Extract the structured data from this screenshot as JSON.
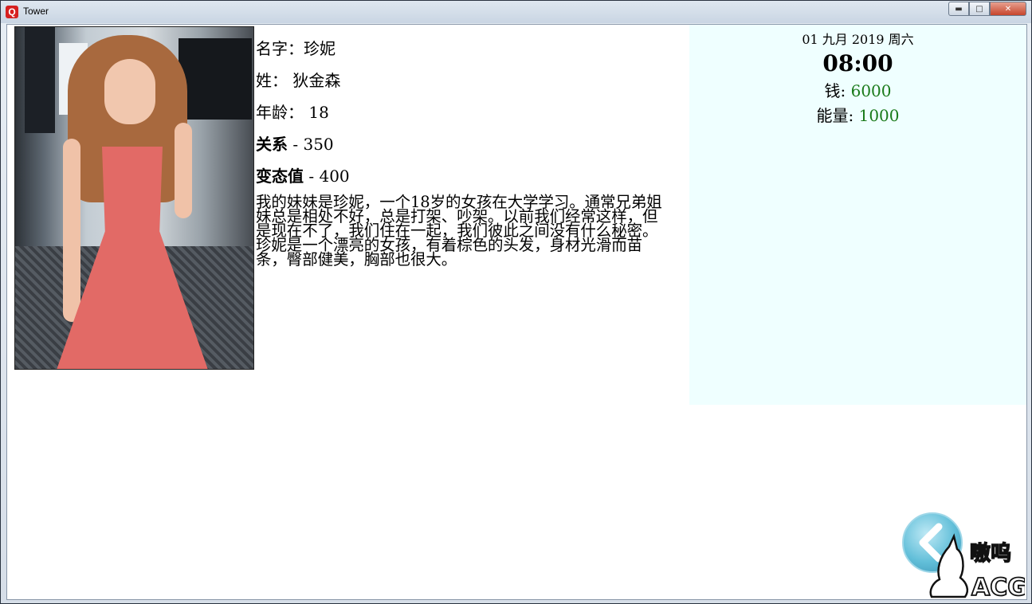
{
  "window": {
    "title": "Tower",
    "app_icon_letter": "Q",
    "min_glyph": "▬",
    "max_glyph": "□",
    "close_glyph": "✕"
  },
  "profile": {
    "name_label": "名字：",
    "name_value": "珍妮",
    "surname_label": "姓：",
    "surname_value": "狄金森",
    "age_label": "年龄：",
    "age_value": "18",
    "relation_label": "关系",
    "relation_value": "- 350",
    "perversion_label": "变态值",
    "perversion_value": "- 400",
    "bio": "我的妹妹是珍妮，一个18岁的女孩在大学学习。通常兄弟姐妹总是相处不好，总是打架、吵架。以前我们经常这样，但是现在不了，我们住在一起，我们彼此之间没有什么秘密。珍妮是一个漂亮的女孩，有着棕色的头发，身材光滑而苗条，臀部健美，胸部也很大。"
  },
  "status": {
    "date": "01 九月 2019 周六",
    "time": "08:00",
    "money_label": "钱:",
    "money_value": "6000",
    "energy_label": "能量:",
    "energy_value": "1000",
    "value_color": "#1a7a1a"
  },
  "watermark": {
    "text_top": "嗷呜",
    "text_bottom": "ACG"
  },
  "icons": {
    "back": "chevron-left-icon"
  }
}
